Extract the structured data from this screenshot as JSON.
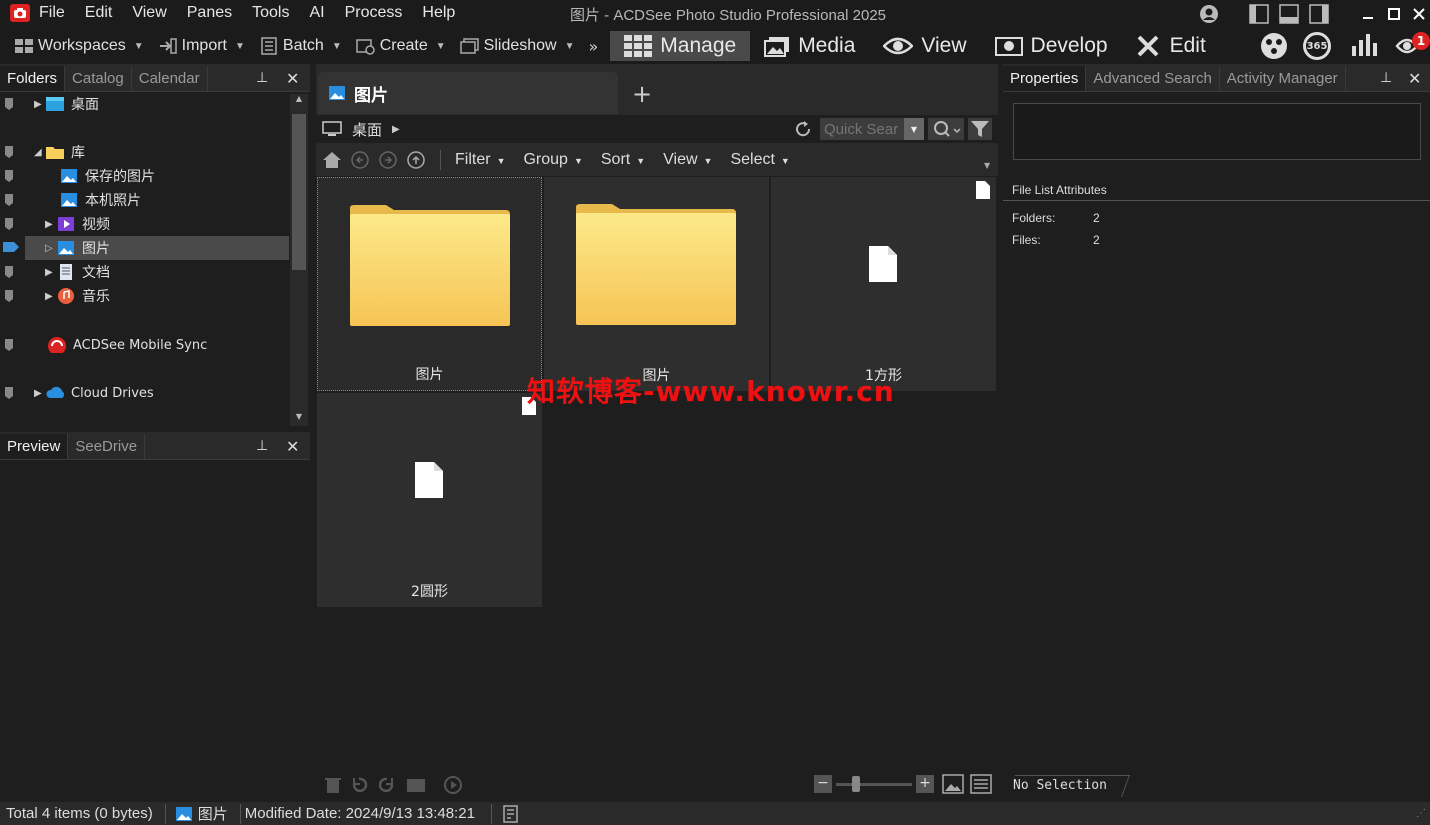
{
  "app": {
    "title": "图片 - ACDSee Photo Studio Professional 2025"
  },
  "menu": [
    "File",
    "Edit",
    "View",
    "Panes",
    "Tools",
    "AI",
    "Process",
    "Help"
  ],
  "toolbar": {
    "workspaces": "Workspaces",
    "import": "Import",
    "batch": "Batch",
    "create": "Create",
    "slideshow": "Slideshow",
    "more": "»",
    "modes": [
      "Manage",
      "Media",
      "View",
      "Develop",
      "Edit"
    ],
    "active_mode": "Manage",
    "icon_365": "365",
    "notify_count": "1"
  },
  "left_panel": {
    "tabs": [
      "Folders",
      "Catalog",
      "Calendar"
    ],
    "pin": "📌",
    "close": "✕",
    "tree": [
      {
        "label": "桌面",
        "icon": "desktop-icon"
      },
      {
        "label": "库",
        "icon": "folder-icon"
      },
      {
        "label": "保存的图片",
        "icon": "pictures-icon"
      },
      {
        "label": "本机照片",
        "icon": "pictures-icon"
      },
      {
        "label": "视频",
        "icon": "video-icon"
      },
      {
        "label": "图片",
        "icon": "pictures-icon"
      },
      {
        "label": "文档",
        "icon": "document-icon"
      },
      {
        "label": "音乐",
        "icon": "music-icon"
      },
      {
        "label": "ACDSee Mobile Sync",
        "icon": "mobile-sync-icon"
      },
      {
        "label": "Cloud Drives",
        "icon": "cloud-icon"
      }
    ]
  },
  "preview_panel": {
    "tabs": [
      "Preview",
      "SeeDrive"
    ]
  },
  "center": {
    "doc_tab": "图片",
    "add_tab": "+",
    "path": "桌面",
    "quick_search_placeholder": "Quick Sear",
    "nav": [
      "Filter",
      "Group",
      "Sort",
      "View",
      "Select"
    ],
    "items": [
      {
        "name": "图片",
        "type": "folder"
      },
      {
        "name": "图片",
        "type": "folder"
      },
      {
        "name": "1方形",
        "type": "file"
      },
      {
        "name": "2圆形",
        "type": "file"
      }
    ]
  },
  "right_panel": {
    "tabs": [
      "Properties",
      "Advanced Search",
      "Activity Manager"
    ],
    "section": "File List Attributes",
    "folders_label": "Folders:",
    "folders_value": "2",
    "files_label": "Files:",
    "files_value": "2",
    "no_selection": "No Selection"
  },
  "status": {
    "total": "Total 4 items  (0 bytes)",
    "location": "图片",
    "modified": "Modified Date: 2024/9/13 13:48:21"
  },
  "watermark": "知软博客-www.knowr.cn",
  "colors": {
    "accent_blue": "#3a8fd6",
    "folder_yellow": "#f7cf5a",
    "watermark_red": "#e11111"
  }
}
